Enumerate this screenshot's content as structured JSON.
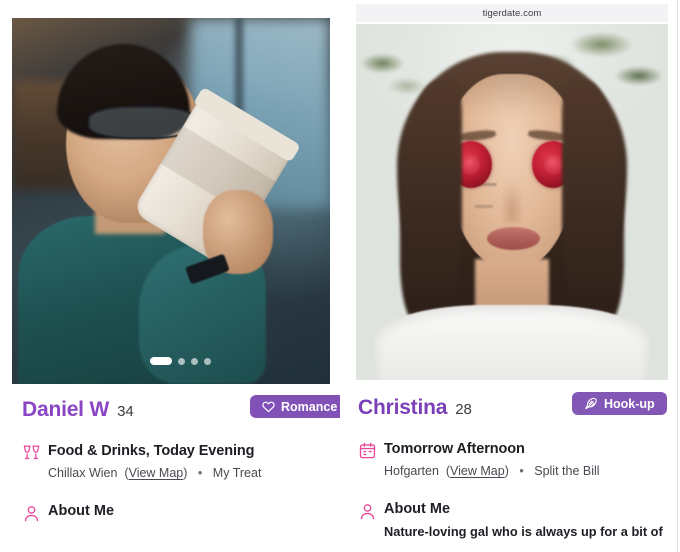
{
  "browser": {
    "url": "tigerdate.com"
  },
  "cards": [
    {
      "id": "daniel",
      "photo_alt": "man-drinking-coffee-photo",
      "carousel": {
        "total": 4,
        "active": 1
      },
      "name": "Daniel W",
      "age": "34",
      "badge": {
        "label": "Romance",
        "icon": "heart-icon",
        "color": "#8151b8"
      },
      "detail": {
        "icon": "cheers-glasses-icon",
        "title": "Food & Drinks, Today Evening",
        "place": "Chillax Wien",
        "map_link": "View Map",
        "separator": "•",
        "payment": "My Treat"
      },
      "about": {
        "icon": "person-icon",
        "title": "About Me",
        "text": ""
      }
    },
    {
      "id": "christina",
      "photo_alt": "woman-with-roses-photo",
      "carousel": {
        "total": 1,
        "active": 1
      },
      "name": "Christina",
      "age": "28",
      "badge": {
        "label": "Hook-up",
        "icon": "feather-icon",
        "color": "#8257b5"
      },
      "detail": {
        "icon": "calendar-icon",
        "title": "Tomorrow Afternoon",
        "place": "Hofgarten",
        "map_link": "View Map",
        "separator": "•",
        "payment": "Split the Bill"
      },
      "about": {
        "icon": "person-icon",
        "title": "About Me",
        "text": "Nature-loving gal who is always up for a bit of"
      }
    }
  ],
  "colors": {
    "name_purple": "#8a45c4",
    "badge_purple": "#8151b8",
    "icon_pink": "#ec4899",
    "text_dark": "#1e1e24",
    "text_muted": "#4a4a52"
  }
}
